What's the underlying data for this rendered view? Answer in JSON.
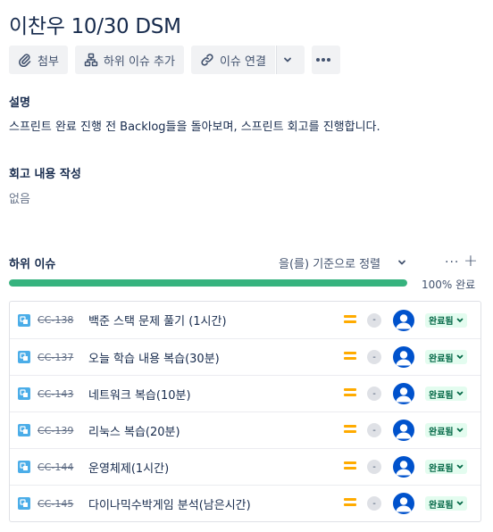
{
  "issue": {
    "title": "이찬우 10/30 DSM"
  },
  "toolbar": {
    "attach_label": "첨부",
    "add_child_label": "하위 이슈 추가",
    "link_label": "이슈 연결"
  },
  "description": {
    "label": "설명",
    "text": "스프린트 완료 진행 전 Backlog들을 돌아보며, 스프린트 회고를 진행합니다."
  },
  "retro": {
    "label": "회고 내용 작성",
    "value": "없음"
  },
  "child_issues": {
    "title": "하위 이슈",
    "sort_label": "을(를) 기준으로 정렬",
    "more_label": "···",
    "add_label": "+",
    "progress_percent": 100,
    "progress_label": "100% 완료",
    "items": [
      {
        "key": "CC-138",
        "summary": "백준 스택 문제 풀기 (1시간)",
        "priority_icon": "priority-medium-icon",
        "dash": "-",
        "status": "완료됨"
      },
      {
        "key": "CC-137",
        "summary": "오늘 학습 내용 복습(30분)",
        "priority_icon": "priority-medium-icon",
        "dash": "-",
        "status": "완료됨"
      },
      {
        "key": "CC-143",
        "summary": "네트워크 복습(10분)",
        "priority_icon": "priority-medium-icon",
        "dash": "-",
        "status": "완료됨"
      },
      {
        "key": "CC-139",
        "summary": "리눅스 복습(20분)",
        "priority_icon": "priority-medium-icon",
        "dash": "-",
        "status": "완료됨"
      },
      {
        "key": "CC-144",
        "summary": "운영체제(1시간)",
        "priority_icon": "priority-medium-icon",
        "dash": "-",
        "status": "완료됨"
      },
      {
        "key": "CC-145",
        "summary": "다이나믹수박게임 분석(남은시간)",
        "priority_icon": "priority-medium-icon",
        "dash": "-",
        "status": "완료됨"
      }
    ]
  },
  "colors": {
    "progress": "#36b37e",
    "priority_medium": "#ffab00",
    "status_done_bg": "#e3fcef",
    "status_done_text": "#006644",
    "avatar": "#0052cc",
    "subtask_icon": "#4bade8"
  }
}
